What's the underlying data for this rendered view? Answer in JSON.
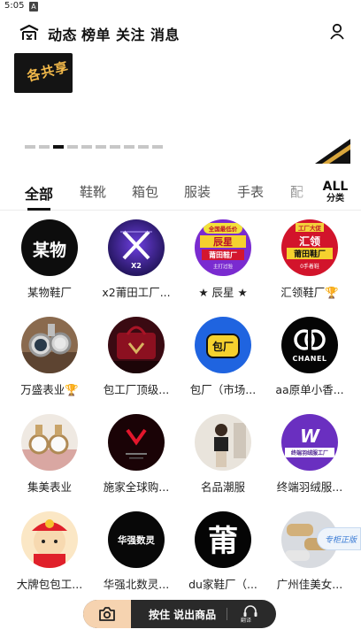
{
  "status": {
    "time": "5:05",
    "indicator": "A"
  },
  "nav": {
    "tabs": [
      "动态",
      "榜单",
      "关注",
      "消息"
    ],
    "logo_icon": "house-logo-icon",
    "profile_icon": "person-icon"
  },
  "banner": {
    "left_text": "各共享",
    "dot_count": 10,
    "active_dot": 2
  },
  "categories": {
    "tabs": [
      "全部",
      "鞋靴",
      "箱包",
      "服装",
      "手表",
      "配"
    ],
    "active_index": 0,
    "all_big": "ALL",
    "all_small": "分类"
  },
  "shops": [
    {
      "name": "某物鞋厂",
      "avatar_text": "某物"
    },
    {
      "name": "x2莆田工厂...",
      "avatar_text": "X2"
    },
    {
      "name": "★ 辰星 ★",
      "avatar_text": "辰星",
      "avatar_sub": "莆田鞋厂",
      "avatar_top": "全国最低价",
      "avatar_foot": "主打过验"
    },
    {
      "name": "汇领鞋厂🏆",
      "avatar_text": "汇领",
      "avatar_sub": "莆田鞋厂",
      "avatar_top": "工厂大促",
      "avatar_foot": "0手着鞋"
    },
    {
      "name": "万盛表业🏆",
      "avatar_text": ""
    },
    {
      "name": "包工厂顶级...",
      "avatar_text": ""
    },
    {
      "name": "包厂（市场...",
      "avatar_text": "包厂"
    },
    {
      "name": "aa原单小香...",
      "avatar_text": "CHANEL"
    },
    {
      "name": "集美表业",
      "avatar_text": ""
    },
    {
      "name": "施家全球购...",
      "avatar_text": ""
    },
    {
      "name": "名品潮服",
      "avatar_text": ""
    },
    {
      "name": "终端羽绒服...",
      "avatar_text": "W",
      "avatar_sub": "终端羽绒服工厂"
    },
    {
      "name": "大牌包包工...",
      "avatar_text": ""
    },
    {
      "name": "华强北数灵...",
      "avatar_text": "华强数灵"
    },
    {
      "name": "du家鞋厂（...",
      "avatar_text": "莆"
    },
    {
      "name": "广州佳美女...",
      "avatar_text": ""
    }
  ],
  "float_badge": "专柜正版",
  "voice": {
    "camera_icon": "camera-icon",
    "label": "按住 说出商品",
    "translate_icon": "headset-icon",
    "translate_label": "翻译"
  },
  "colors": {
    "accent_dark": "#111111",
    "voice_bar": "#2a2a2a",
    "camera_bg": "#f6d3b0"
  }
}
